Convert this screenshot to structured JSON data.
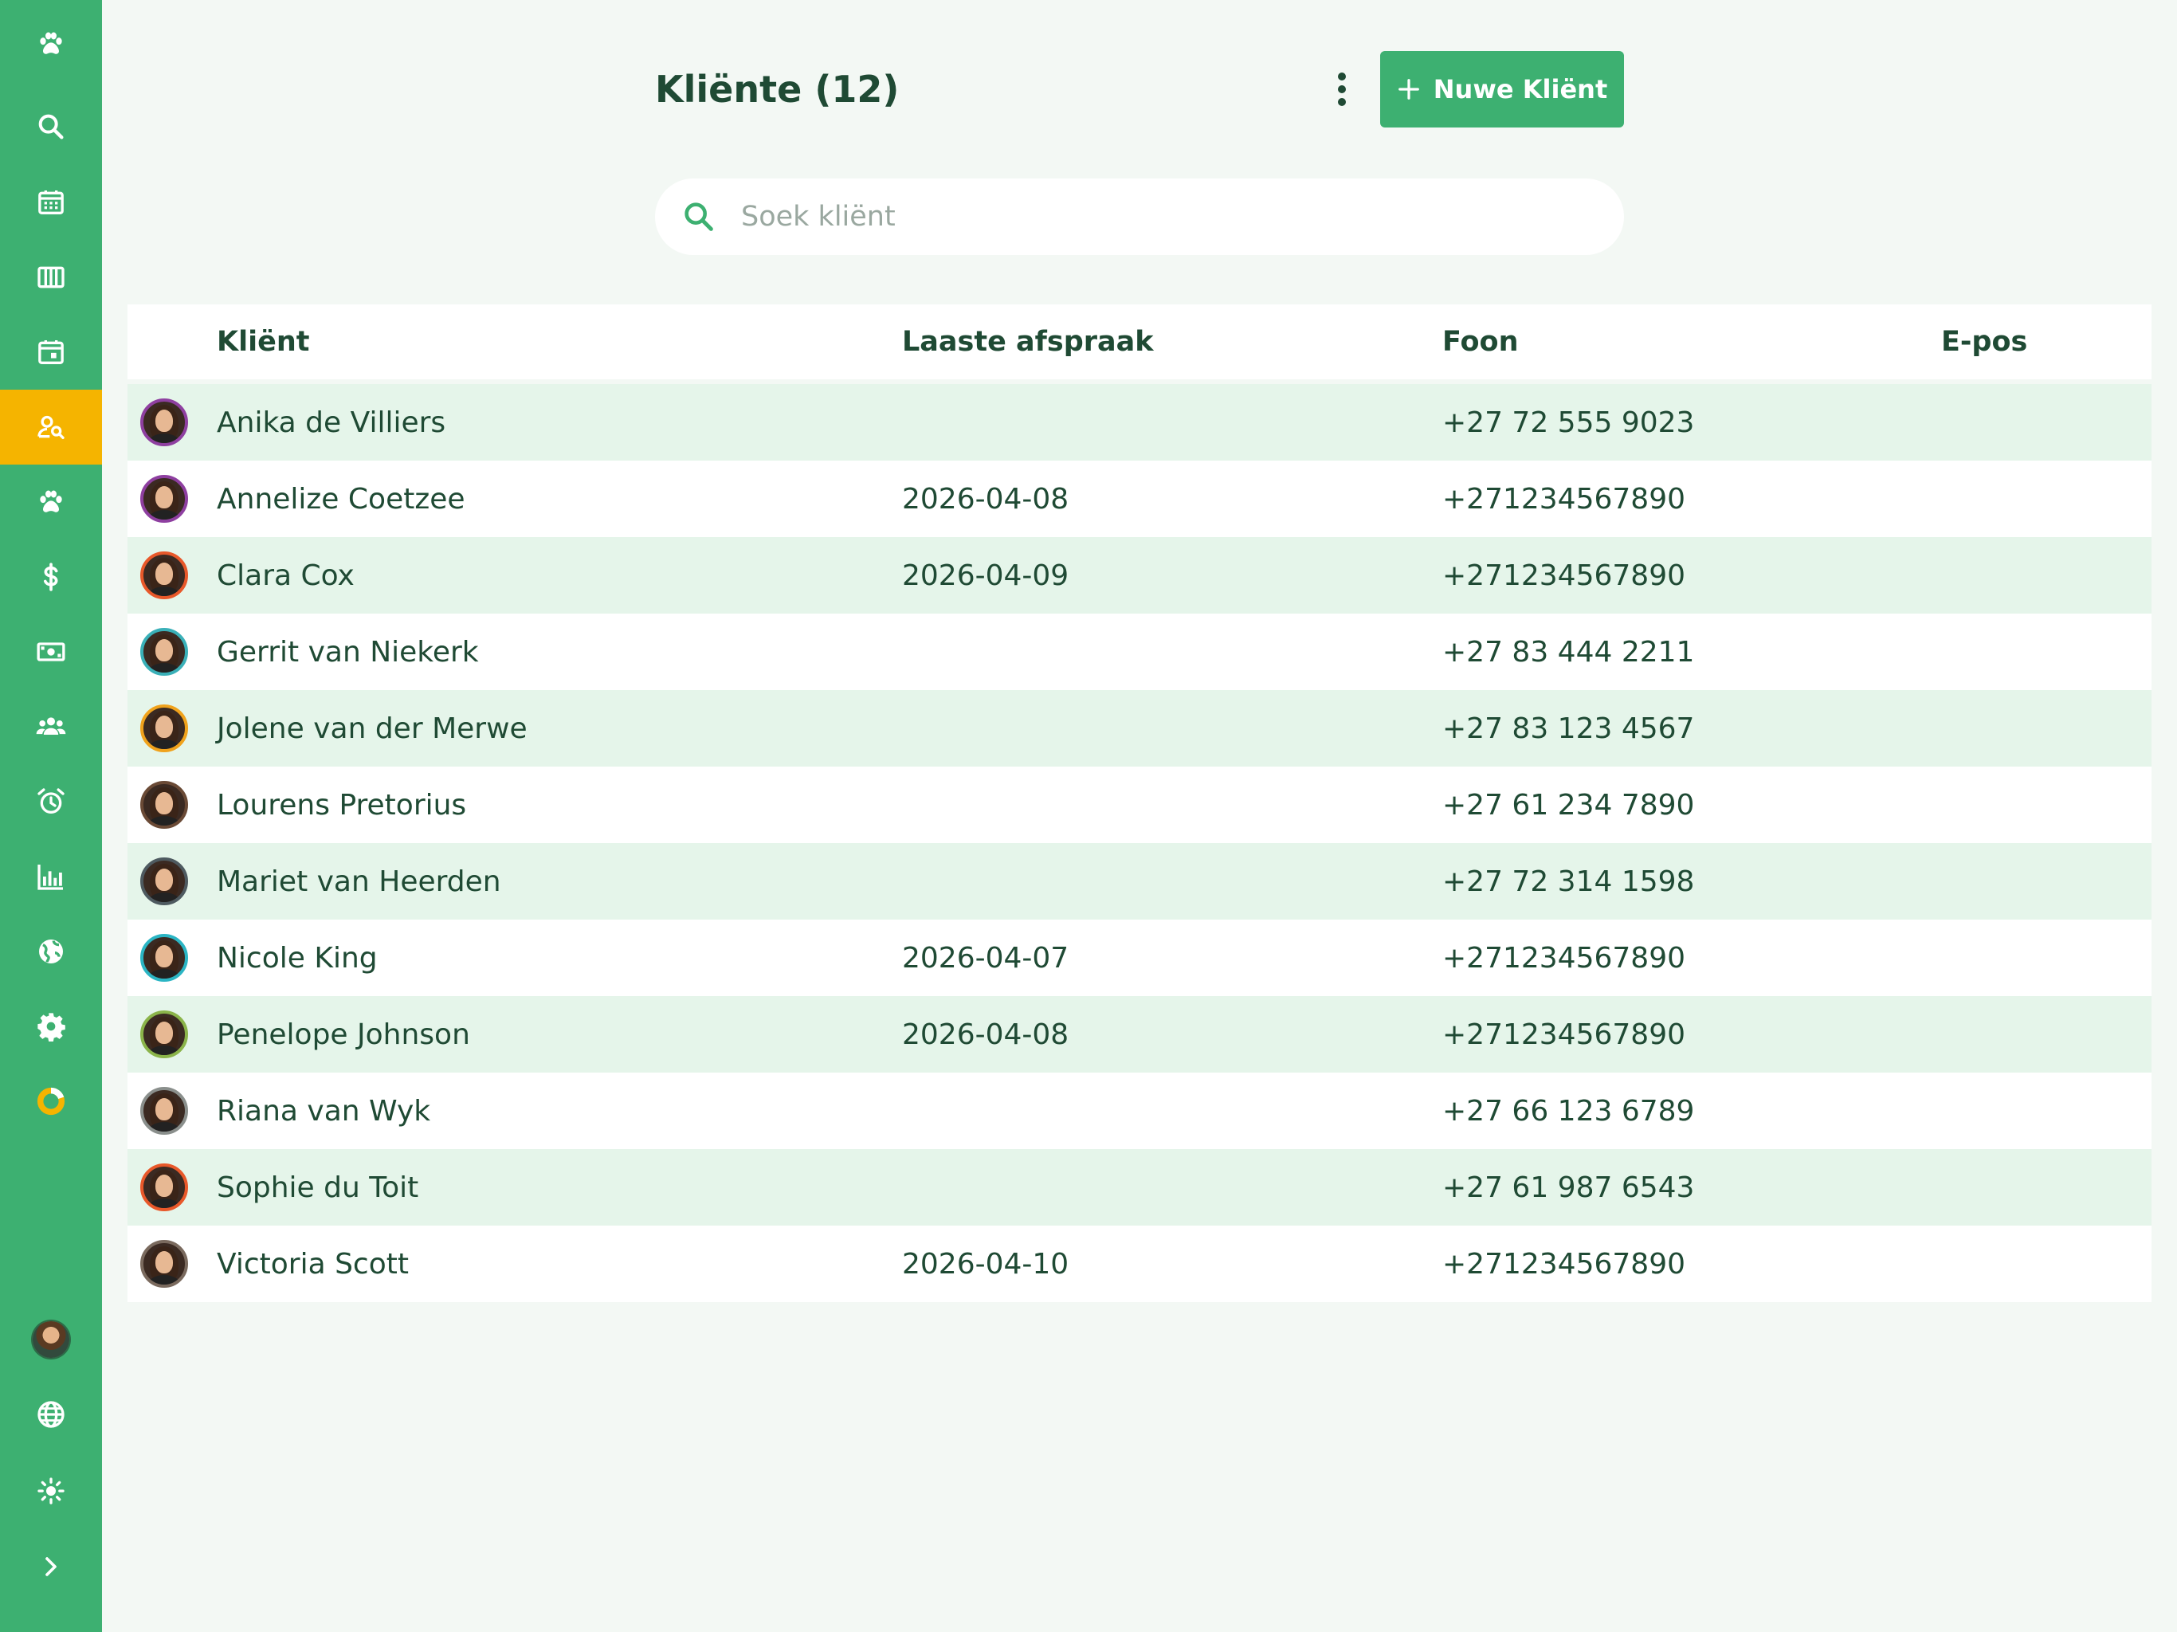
{
  "sidebar": {
    "items": [
      {
        "icon": "paw-icon"
      },
      {
        "icon": "search-icon"
      },
      {
        "icon": "calendar-grid-icon"
      },
      {
        "icon": "columns-icon"
      },
      {
        "icon": "calendar-day-icon"
      },
      {
        "icon": "client-search-icon",
        "active": true
      },
      {
        "icon": "paw-icon"
      },
      {
        "icon": "dollar-icon"
      },
      {
        "icon": "cash-icon"
      },
      {
        "icon": "group-icon"
      },
      {
        "icon": "alarm-icon"
      },
      {
        "icon": "bar-chart-icon"
      },
      {
        "icon": "globe-filled-icon"
      },
      {
        "icon": "gear-icon"
      },
      {
        "icon": "progress-ring-icon"
      }
    ],
    "bottom": [
      {
        "icon": "user-avatar"
      },
      {
        "icon": "globe-icon"
      },
      {
        "icon": "sun-icon"
      },
      {
        "icon": "chevron-right-icon"
      }
    ]
  },
  "header": {
    "title": "Kliënte (12)",
    "new_button_label": "Nuwe Kliënt"
  },
  "search": {
    "placeholder": "Soek kliënt",
    "value": ""
  },
  "table": {
    "columns": [
      "Kliënt",
      "Laaste afspraak",
      "Foon",
      "E-pos"
    ],
    "rows": [
      {
        "name": "Anika de Villiers",
        "last_appointment": "",
        "phone": "+27 72 555 9023",
        "email": "",
        "avatar_ring": "#8e3fa0"
      },
      {
        "name": "Annelize Coetzee",
        "last_appointment": "2026-04-08",
        "phone": "+271234567890",
        "email": "",
        "avatar_ring": "#8e3fa0"
      },
      {
        "name": "Clara Cox",
        "last_appointment": "2026-04-09",
        "phone": "+271234567890",
        "email": "",
        "avatar_ring": "#e8582a"
      },
      {
        "name": "Gerrit van Niekerk",
        "last_appointment": "",
        "phone": "+27 83 444 2211",
        "email": "",
        "avatar_ring": "#3ab0b8"
      },
      {
        "name": "Jolene van der Merwe",
        "last_appointment": "",
        "phone": "+27 83 123 4567",
        "email": "",
        "avatar_ring": "#f0a21c"
      },
      {
        "name": "Lourens Pretorius",
        "last_appointment": "",
        "phone": "+27 61 234 7890",
        "email": "",
        "avatar_ring": "#6a4a36"
      },
      {
        "name": "Mariet van Heerden",
        "last_appointment": "",
        "phone": "+27 72 314 1598",
        "email": "",
        "avatar_ring": "#4e5a60"
      },
      {
        "name": "Nicole King",
        "last_appointment": "2026-04-07",
        "phone": "+271234567890",
        "email": "",
        "avatar_ring": "#2bb5c4"
      },
      {
        "name": "Penelope Johnson",
        "last_appointment": "2026-04-08",
        "phone": "+271234567890",
        "email": "",
        "avatar_ring": "#8bb44a"
      },
      {
        "name": "Riana van Wyk",
        "last_appointment": "",
        "phone": "+27 66 123 6789",
        "email": "",
        "avatar_ring": "#8a8f8c"
      },
      {
        "name": "Sophie du Toit",
        "last_appointment": "",
        "phone": "+27 61 987 6543",
        "email": "",
        "avatar_ring": "#e8582a"
      },
      {
        "name": "Victoria Scott",
        "last_appointment": "2026-04-10",
        "phone": "+271234567890",
        "email": "",
        "avatar_ring": "#7a6a5e"
      }
    ]
  },
  "colors": {
    "brand": "#3db071",
    "active": "#f5b400",
    "text": "#1f4a34",
    "row_alt": "#e5f5ea"
  }
}
